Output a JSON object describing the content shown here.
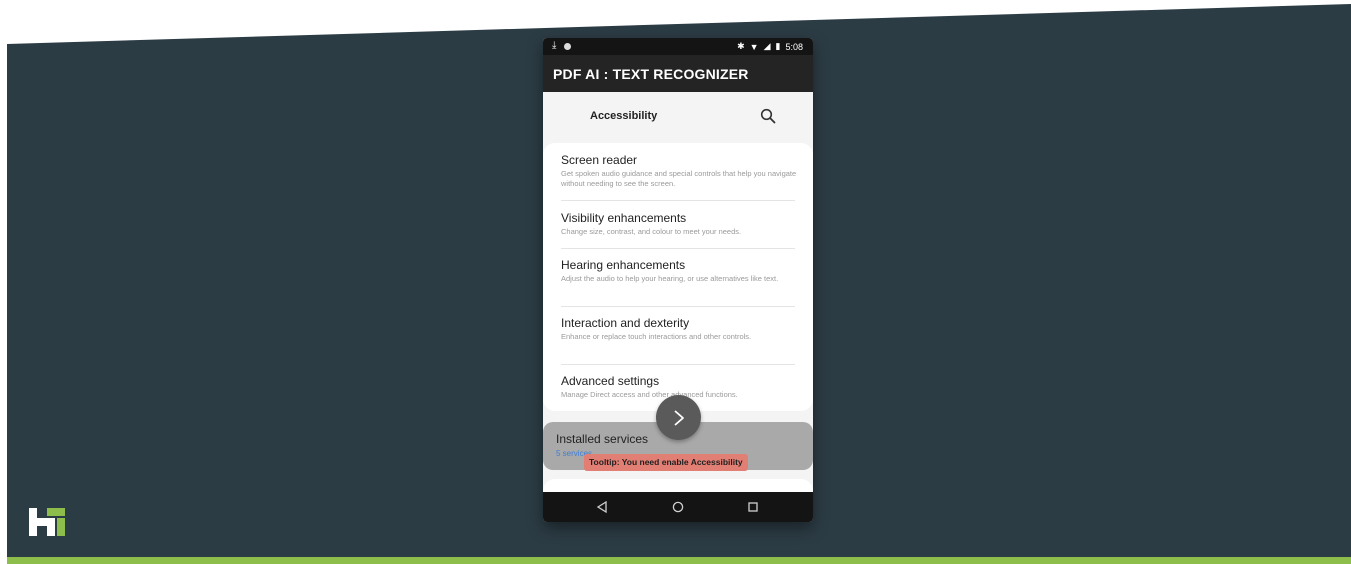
{
  "statusbar": {
    "time": "5:08"
  },
  "app": {
    "title": "PDF AI : TEXT RECOGNIZER"
  },
  "header": {
    "title": "Accessibility"
  },
  "items": [
    {
      "title": "Screen reader",
      "subtitle": "Get spoken audio guidance and special controls that help you navigate without needing to see the screen."
    },
    {
      "title": "Visibility enhancements",
      "subtitle": "Change size, contrast, and colour to meet your needs."
    },
    {
      "title": "Hearing enhancements",
      "subtitle": "Adjust the audio to help your hearing, or use alternatives like text."
    },
    {
      "title": "Interaction and dexterity",
      "subtitle": "Enhance or replace touch interactions and other controls."
    },
    {
      "title": "Advanced settings",
      "subtitle": "Manage Direct access and other advanced functions."
    }
  ],
  "installed": {
    "title": "Installed services",
    "subtitle": "5 services"
  },
  "tooltip": {
    "text": "Tooltip: You need enable Accessibility"
  },
  "colors": {
    "background": "#2c3c45",
    "stripe": "#8dbe4b",
    "tooltip": "#e27f74",
    "link": "#3e7fd6"
  },
  "icons": {
    "search": "search-icon",
    "next": "chevron-right-icon",
    "back": "back-triangle-icon",
    "home": "home-circle-icon",
    "recents": "recents-square-icon"
  }
}
